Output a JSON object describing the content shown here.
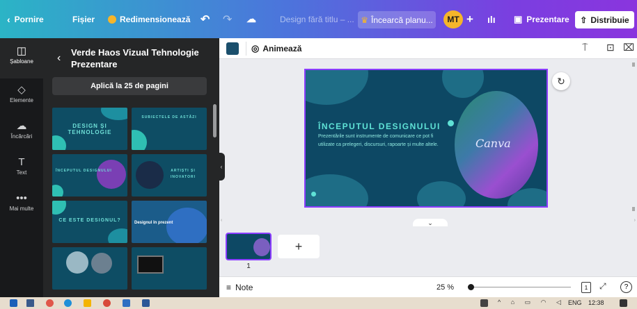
{
  "topbar": {
    "home_label": "Pornire",
    "file_label": "Fișier",
    "resize_label": "Redimensionează",
    "undo_icon": "undo-icon",
    "redo_icon": "redo-icon",
    "cloud_icon": "cloud-save-icon",
    "doc_title": "Design fără titlu – ...",
    "upgrade_label": "Încearcă planu...",
    "avatar_initials": "MT",
    "add_icon": "+",
    "stats_icon": "chart-icon",
    "present_label": "Prezentare",
    "share_label": "Distribuie"
  },
  "rail": {
    "items": [
      {
        "label": "Șabloane",
        "icon": "template-icon"
      },
      {
        "label": "Elemente",
        "icon": "elements-icon"
      },
      {
        "label": "Încărcări",
        "icon": "upload-icon"
      },
      {
        "label": "Text",
        "icon": "text-icon"
      },
      {
        "label": "Mai multe",
        "icon": "more-icon"
      }
    ]
  },
  "panel": {
    "title": "Verde Haos Vizual Tehnologie Prezentare",
    "apply_label": "Aplică la 25 de pagini",
    "thumbs": [
      {
        "text": "DESIGN ȘI TEHNOLOGIE"
      },
      {
        "text": "SUBIECTELE DE ASTĂZI"
      },
      {
        "text": "ÎNCEPUTUL DESIGNULUI"
      },
      {
        "text": "ARTIȘTI ȘI INOVATORI"
      },
      {
        "text": "CE ESTE DESIGNUL?"
      },
      {
        "text": "Designul în prezent"
      },
      {
        "text": ""
      },
      {
        "text": ""
      }
    ]
  },
  "toolbar": {
    "color_swatch": "#1b4f6c",
    "animate_label": "Animează"
  },
  "slide": {
    "heading": "ÎNCEPUTUL DESIGNULUI",
    "body": "Prezentările sunt instrumente de comunicare ce pot fi utilizate ca prelegeri, discursuri, rapoarte și multe altele.",
    "logo_text": "Canva"
  },
  "strip": {
    "page_number": "1",
    "add_page": "+"
  },
  "footer": {
    "notes_label": "Note",
    "zoom_value": "25 %",
    "page_count": "1",
    "help": "?"
  },
  "taskbar": {
    "lang": "ENG",
    "time": "12:38"
  },
  "colors": {
    "accent": "#8b3dff",
    "slide_bg": "#0d4864",
    "teal": "#2fbfb3"
  }
}
